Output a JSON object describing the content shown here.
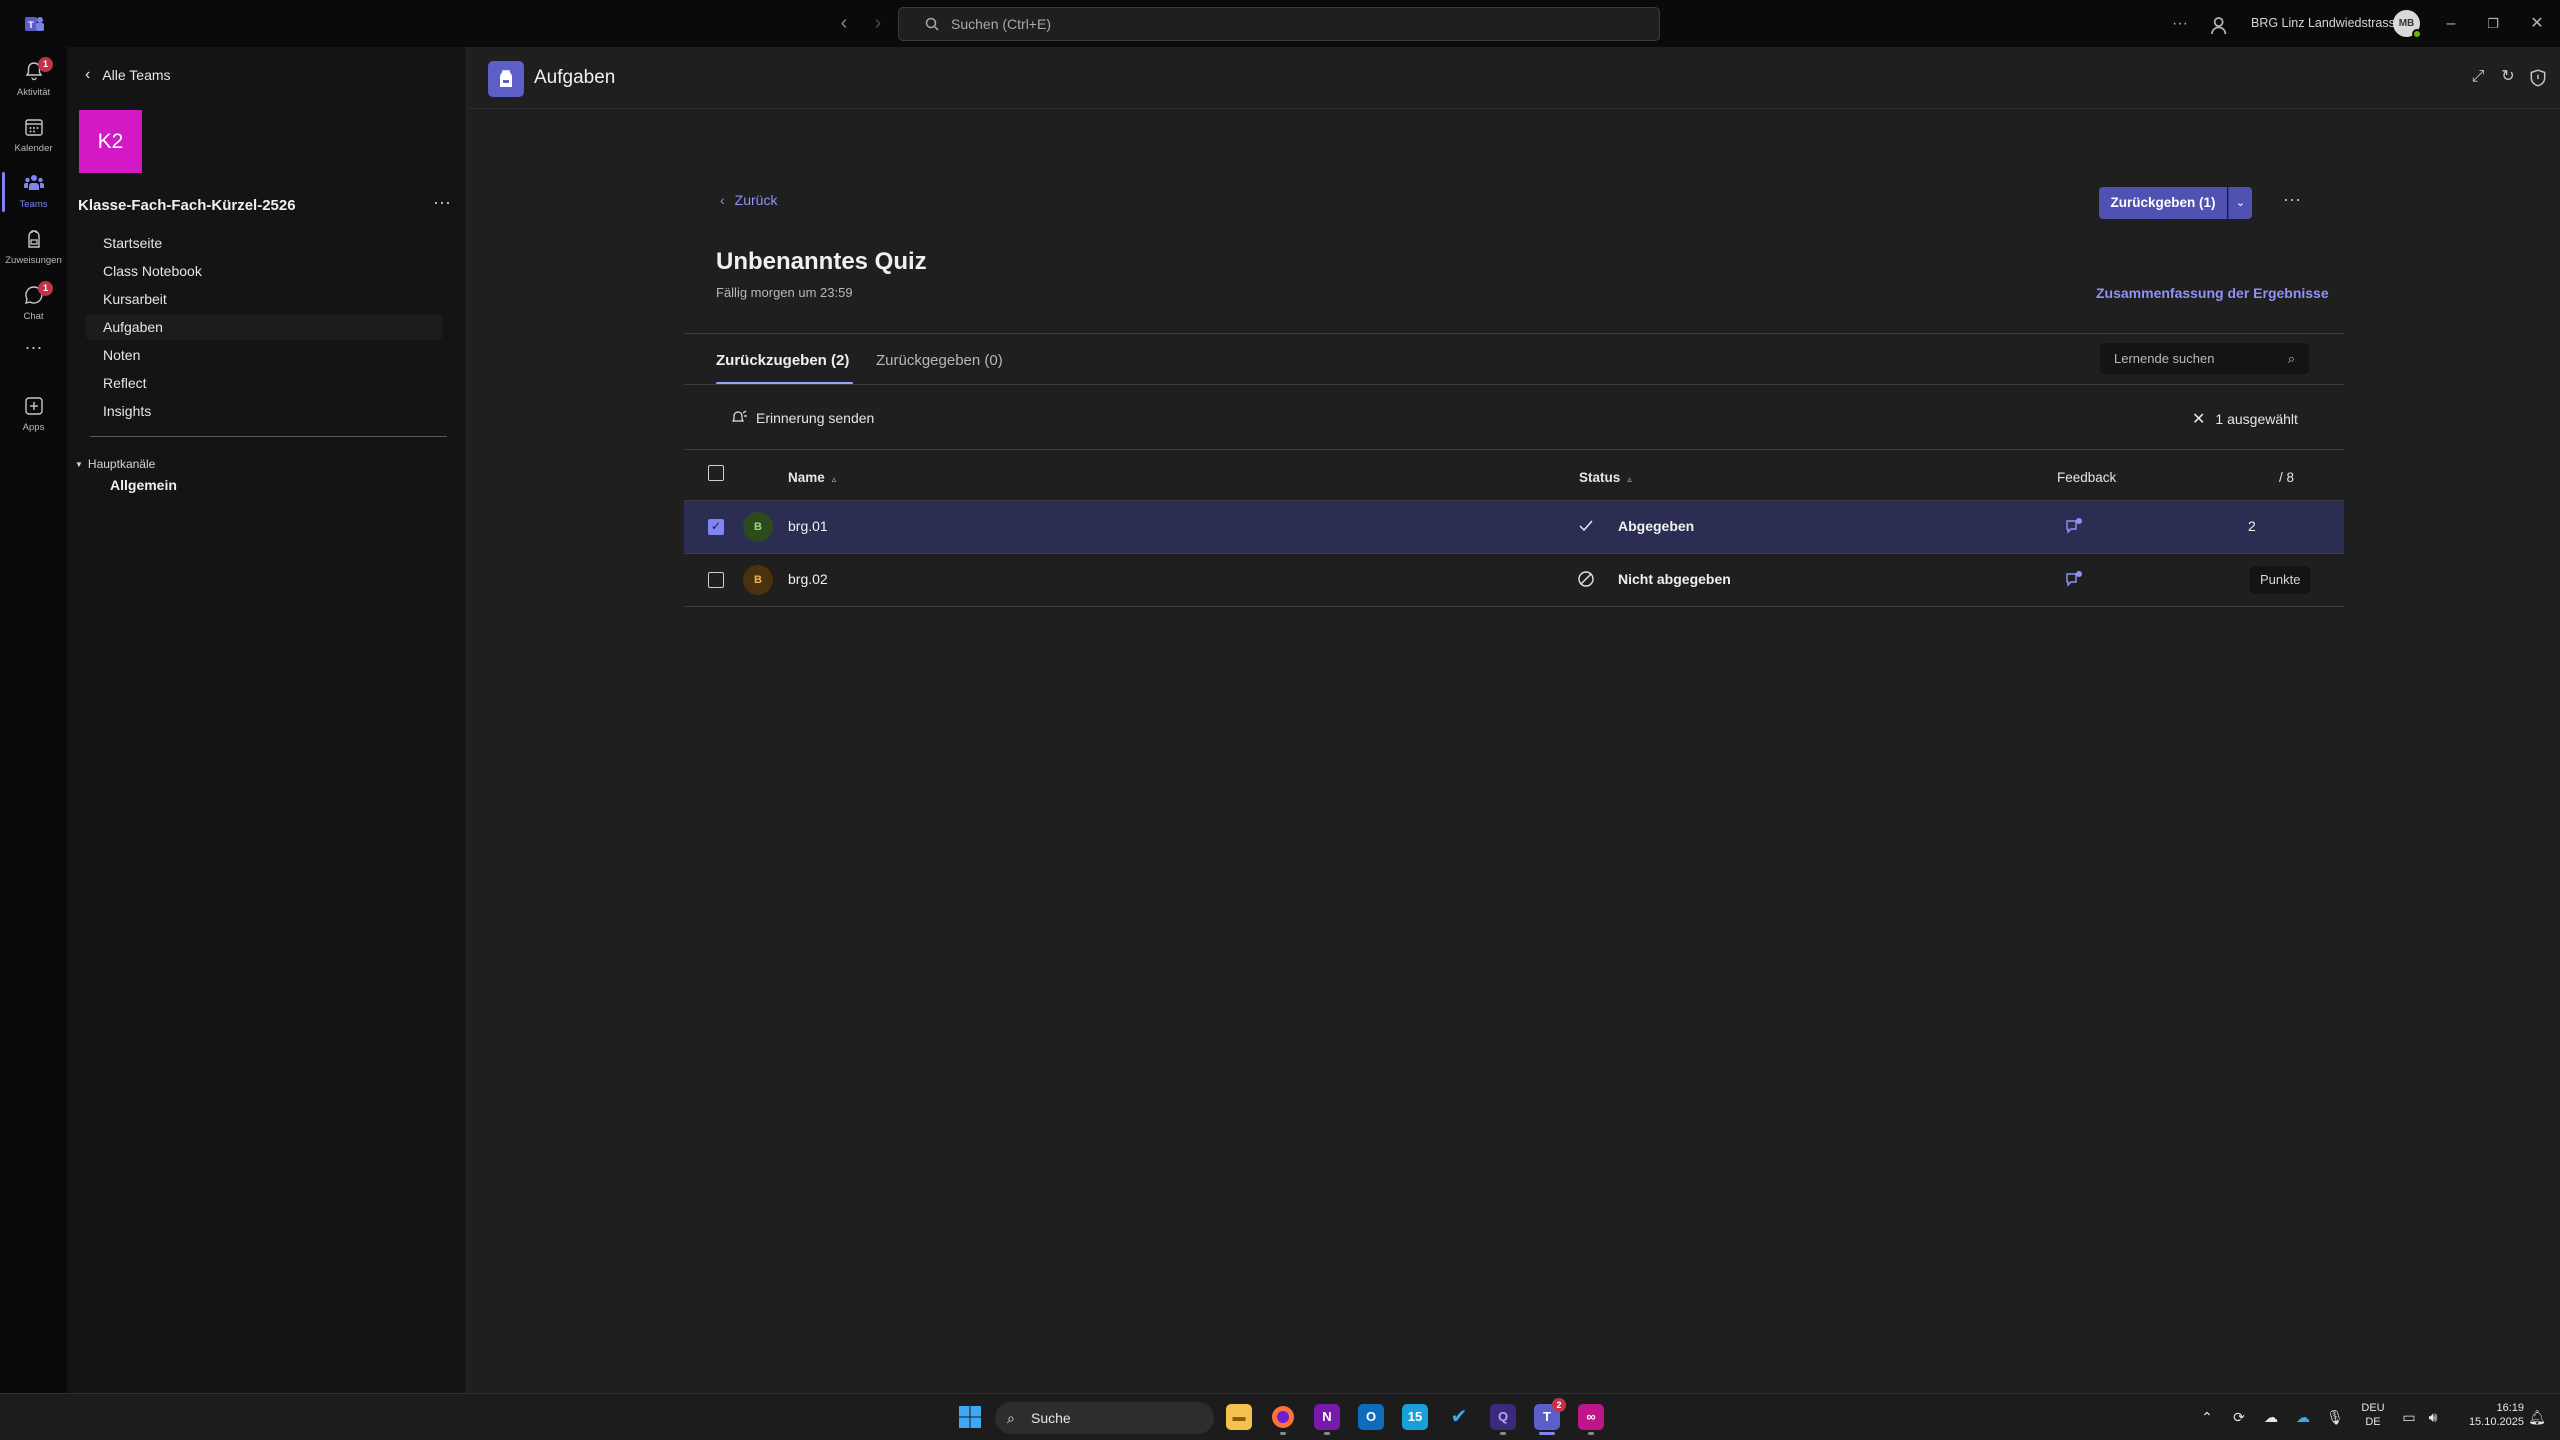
{
  "titlebar": {
    "search_placeholder": "Suchen (Ctrl+E)",
    "org_name": "BRG Linz Landwiedstrasse",
    "avatar_initials": "MB"
  },
  "rail": {
    "items": [
      {
        "label": "Aktivität",
        "badge": "1"
      },
      {
        "label": "Kalender"
      },
      {
        "label": "Teams"
      },
      {
        "label": "Zuweisungen"
      },
      {
        "label": "Chat",
        "badge": "1"
      },
      {
        "label": "Apps"
      }
    ]
  },
  "team": {
    "back_label": "Alle Teams",
    "tile_text": "K2",
    "name": "Klasse-Fach-Fach-Kürzel-2526",
    "nav": [
      "Startseite",
      "Class Notebook",
      "Kursarbeit",
      "Aufgaben",
      "Noten",
      "Reflect",
      "Insights"
    ],
    "channels_header": "Hauptkanäle",
    "channel": "Allgemein"
  },
  "header": {
    "title": "Aufgaben"
  },
  "assignment": {
    "back_label": "Zurück",
    "primary_button": "Zurückgeben (1)",
    "title": "Unbenanntes Quiz",
    "due": "Fällig morgen um 23:59",
    "summary_link": "Zusammenfassung der Ergebnisse",
    "tabs": [
      "Zurückzugeben (2)",
      "Zurückgegeben (0)"
    ],
    "search_placeholder": "Lernende suchen",
    "remind_label": "Erinnerung senden",
    "selected_label": "1 ausgewählt",
    "columns": {
      "name": "Name",
      "status": "Status",
      "feedback": "Feedback",
      "points": "/ 8"
    },
    "rows": [
      {
        "initial": "B",
        "name": "brg.01",
        "status": "Abgegeben",
        "score": "2",
        "selected": true,
        "avatar_bg": "#2d4a1c",
        "avatar_fg": "#9fd67c"
      },
      {
        "initial": "B",
        "name": "brg.02",
        "status": "Nicht abgegeben",
        "score_placeholder": "Punkte",
        "selected": false,
        "avatar_bg": "#4a3110",
        "avatar_fg": "#f2b45a"
      }
    ]
  },
  "taskbar": {
    "search_label": "Suche",
    "teams_badge": "2",
    "lang_top": "DEU",
    "lang_bottom": "DE",
    "time": "16:19",
    "date": "15.10.2025"
  },
  "colors": {
    "accent": "#7f85f5",
    "button": "#4f52b2",
    "team_tile": "#d319c5"
  }
}
